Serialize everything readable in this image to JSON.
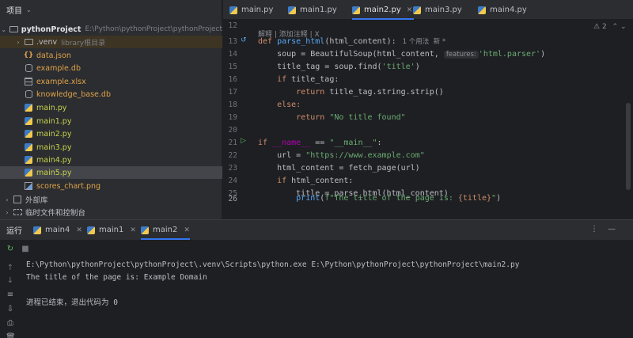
{
  "project": {
    "header": "项目",
    "root": {
      "name": "pythonProject",
      "path": "E:\\Python\\pythonProject\\pythonProject"
    },
    "items": [
      {
        "name": ".venv",
        "hint": "library根目录",
        "type": "folder"
      },
      {
        "name": "data.json",
        "type": "json"
      },
      {
        "name": "example.db",
        "type": "db"
      },
      {
        "name": "example.xlsx",
        "type": "xlsx"
      },
      {
        "name": "knowledge_base.db",
        "type": "db"
      },
      {
        "name": "main.py",
        "type": "py"
      },
      {
        "name": "main1.py",
        "type": "py"
      },
      {
        "name": "main2.py",
        "type": "py"
      },
      {
        "name": "main3.py",
        "type": "py"
      },
      {
        "name": "main4.py",
        "type": "py"
      },
      {
        "name": "main5.py",
        "type": "py"
      },
      {
        "name": "scores_chart.png",
        "type": "png"
      }
    ],
    "external": "外部库",
    "scratches": "临时文件和控制台"
  },
  "editor": {
    "tabs": [
      {
        "label": "main.py"
      },
      {
        "label": "main1.py"
      },
      {
        "label": "main2.py"
      },
      {
        "label": "main3.py"
      },
      {
        "label": "main4.py"
      }
    ],
    "problems": "2",
    "lens": "解释 | 添加注释 | X",
    "usage": "1 个用法  新 *",
    "param_hint": "features:",
    "line_numbers": [
      "12",
      "13",
      "14",
      "15",
      "16",
      "17",
      "18",
      "19",
      "20",
      "21",
      "22",
      "23",
      "24",
      "25",
      "26"
    ],
    "code": {
      "l13_kw": "def ",
      "l13_fn": "parse_html",
      "l13_rest": "(html_content):",
      "l14_a": "    soup = BeautifulSoup(html_content, ",
      "l14_str": "'html.parser'",
      "l14_end": ")",
      "l15_a": "    title_tag = soup.find(",
      "l15_str": "'title'",
      "l15_end": ")",
      "l16_kw": "    if ",
      "l16_rest": "title_tag:",
      "l17_kw": "        return ",
      "l17_rest": "title_tag.string.strip()",
      "l18_kw": "    else:",
      "l19_kw": "        return ",
      "l19_str": "\"No title found\"",
      "l21_kw": "if ",
      "l21_d": "__name__",
      "l21_eq": " == ",
      "l21_str": "\"__main__\"",
      "l21_end": ":",
      "l22_a": "    url = ",
      "l22_str": "\"https://www.example.com\"",
      "l23": "    html_content = fetch_page(url)",
      "l24_kw": "    if ",
      "l24_rest": "html_content:",
      "l25": "        title = parse_html(html_content)",
      "l26_fn": "        print",
      "l26_a": "(",
      "l26_str1": "f\"The title of the page is: ",
      "l26_b": "{title}",
      "l26_str2": "\"",
      "l26_end": ")"
    }
  },
  "run": {
    "title": "运行",
    "tabs": [
      {
        "label": "main4"
      },
      {
        "label": "main1"
      },
      {
        "label": "main2"
      }
    ],
    "output": [
      "E:\\Python\\pythonProject\\pythonProject\\.venv\\Scripts\\python.exe E:\\Python\\pythonProject\\pythonProject\\main2.py",
      "The title of the page is: Example Domain",
      "",
      "进程已结束，退出代码为 0"
    ]
  }
}
